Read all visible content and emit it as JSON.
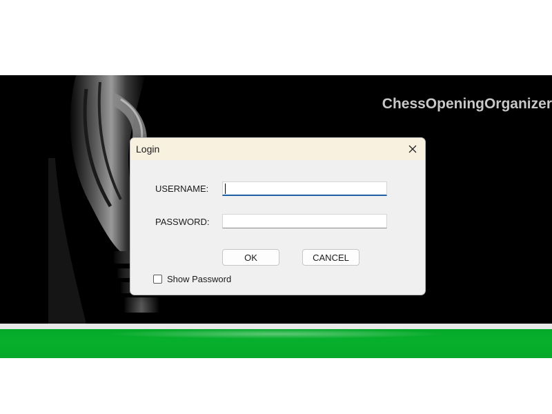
{
  "app": {
    "title": "ChessOpeningOrganizer"
  },
  "dialog": {
    "title": "Login",
    "username_label": "USERNAME:",
    "username_value": "",
    "password_label": "PASSWORD:",
    "password_value": "",
    "ok_label": "OK",
    "cancel_label": "CANCEL",
    "show_password_label": "Show Password",
    "show_password_checked": false
  },
  "colors": {
    "green_bar": "#06b02c",
    "dialog_titlebar": "#f8f1df",
    "dialog_body": "#f0f0f0",
    "focus_accent": "#1f5fa8",
    "hero_background": "#000000"
  },
  "icons": {
    "close": "close-icon",
    "hero": "chess-piece-image"
  }
}
